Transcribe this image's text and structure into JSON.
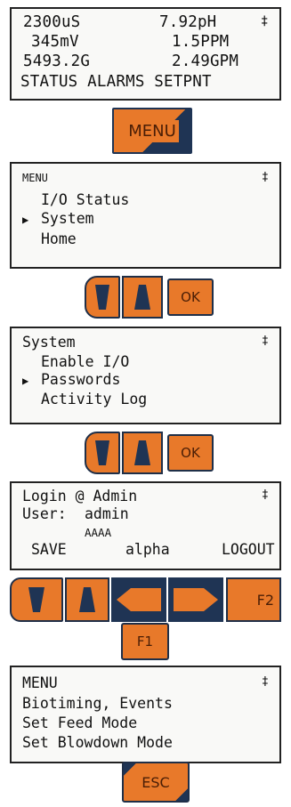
{
  "screen1": {
    "lines": [
      {
        "left": "2300uS",
        "right": "7.92pH"
      },
      {
        "left": "345mV",
        "right": "1.5PPM"
      },
      {
        "left": "5493.2G",
        "right": "2.49GPM"
      }
    ],
    "scroll_indicator": "‡",
    "softkeys": "STATUS ALARMS SETPNT"
  },
  "menu_button_label": "MENU",
  "screen2": {
    "title": "MENU",
    "scroll_indicator": "‡",
    "items": [
      "I/O Status",
      "System",
      "Home"
    ],
    "selected_marker": "▶"
  },
  "nav1": {
    "ok_label": "OK"
  },
  "screen3": {
    "title": "System",
    "scroll_indicator": "‡",
    "items": [
      "Enable I/O",
      "Passwords",
      "Activity Log"
    ],
    "selected_marker": "▶"
  },
  "nav2": {
    "ok_label": "OK"
  },
  "screen4": {
    "line1": "Login @ Admin",
    "user_label": "User:",
    "user_value": "admin",
    "password_mask": "AAAA",
    "scroll_indicator": "‡",
    "softkeys": {
      "left": "SAVE",
      "middle": "alpha",
      "right": "LOGOUT"
    }
  },
  "keypad": {
    "f2_label": "F2",
    "f1_label": "F1"
  },
  "screen5": {
    "title": "MENU",
    "scroll_indicator": "‡",
    "items": [
      "Biotiming, Events",
      "Set Feed Mode",
      "Set Blowdown Mode"
    ]
  },
  "esc_label": "ESC",
  "colors": {
    "button_orange": "#e8792a",
    "button_navy": "#1f3454",
    "lcd_background": "#f9f9f7"
  }
}
